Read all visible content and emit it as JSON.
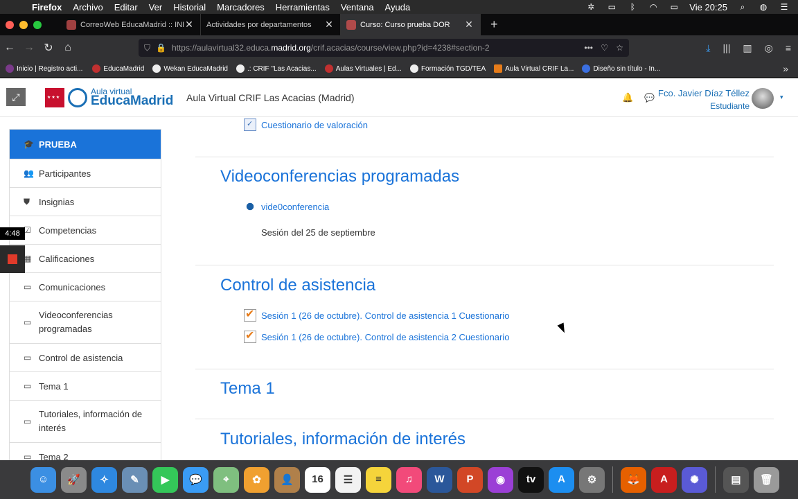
{
  "menubar": {
    "apple": "",
    "app": "Firefox",
    "menus": [
      "Archivo",
      "Editar",
      "Ver",
      "Historial",
      "Marcadores",
      "Herramientas",
      "Ventana",
      "Ayuda"
    ],
    "clock": "Vie 20:25"
  },
  "tabs": [
    {
      "title": "CorreoWeb EducaMadrid :: INB",
      "close": "✕"
    },
    {
      "title": "Actividades por departamentos",
      "close": "✕"
    },
    {
      "title": "Curso: Curso prueba DOR",
      "close": "✕",
      "active": true
    }
  ],
  "newtab": "+",
  "url": {
    "prefix": "https://aulavirtual32.educa.",
    "host": "madrid.org",
    "path": "/crif.acacias/course/view.php?id=4238#section-2"
  },
  "nav": {
    "back": "←",
    "forward": "→",
    "reload": "↻",
    "home": "⌂",
    "more": "•••"
  },
  "bookmarks": [
    "Inicio | Registro acti...",
    "EducaMadrid",
    "Wekan EducaMadrid",
    ".: CRIF \"Las Acacias...",
    "Aulas Virtuales | Ed...",
    "Formación TGD/TEA",
    "Aula Virtual CRIF La...",
    "Diseño sin título - In..."
  ],
  "bookmarks_more": "»",
  "header": {
    "expand": "⤢",
    "logo_line1": "Aula virtual",
    "logo_line2": "EducaMadrid",
    "site_title": "Aula Virtual CRIF Las Acacias (Madrid)",
    "user_name": "Fco. Javier Díaz Téllez",
    "user_role": "Estudiante",
    "bell": "🔔",
    "chat": "💬",
    "caret": "▾"
  },
  "recorder": {
    "time": "4:48"
  },
  "sidebar": {
    "items": [
      {
        "icon": "🎓",
        "label": "PRUEBA"
      },
      {
        "icon": "👥",
        "label": "Participantes"
      },
      {
        "icon": "⛊",
        "label": "Insignias"
      },
      {
        "icon": "☑",
        "label": "Competencias"
      },
      {
        "icon": "▦",
        "label": "Calificaciones"
      },
      {
        "icon": "▭",
        "label": "Comunicaciones"
      },
      {
        "icon": "▭",
        "label": "Videoconferencias programadas"
      },
      {
        "icon": "▭",
        "label": "Control de asistencia"
      },
      {
        "icon": "▭",
        "label": "Tema 1"
      },
      {
        "icon": "▭",
        "label": "Tutoriales, información de interés"
      },
      {
        "icon": "▭",
        "label": "Tema 2"
      }
    ]
  },
  "main": {
    "top_activity": "Cuestionario de valoración",
    "sections": [
      {
        "title": "Videoconferencias programadas",
        "activity": "vide0conferencia",
        "description": "Sesión del 25 de septiembre"
      },
      {
        "title": "Control de asistencia",
        "activities": [
          "Sesión 1 (26 de octubre). Control de asistencia 1 Cuestionario",
          "Sesión 1 (26 de octubre). Control de asistencia 2 Cuestionario"
        ]
      },
      {
        "title": "Tema 1"
      },
      {
        "title": "Tutoriales, información de interés"
      }
    ]
  },
  "dock": {
    "apps": [
      {
        "name": "finder-icon",
        "color": "#3b8fe3",
        "glyph": "☺"
      },
      {
        "name": "launchpad-icon",
        "color": "#8a8a8a",
        "glyph": "🚀"
      },
      {
        "name": "safari-icon",
        "color": "#2e88e0",
        "glyph": "✧"
      },
      {
        "name": "preview-icon",
        "color": "#6a8fb5",
        "glyph": "✎"
      },
      {
        "name": "facetime-icon",
        "color": "#34c759",
        "glyph": "▶"
      },
      {
        "name": "messages-icon",
        "color": "#3a9cf5",
        "glyph": "💬"
      },
      {
        "name": "maps-icon",
        "color": "#7fbf7f",
        "glyph": "⌖"
      },
      {
        "name": "photos-icon",
        "color": "#f0a030",
        "glyph": "✿"
      },
      {
        "name": "contacts-icon",
        "color": "#b0804a",
        "glyph": "👤"
      },
      {
        "name": "calendar-icon",
        "color": "#ffffff",
        "glyph": "16"
      },
      {
        "name": "reminders-icon",
        "color": "#f2f2f2",
        "glyph": "☰"
      },
      {
        "name": "notes-icon",
        "color": "#f5d43b",
        "glyph": "≡"
      },
      {
        "name": "itunes-icon",
        "color": "#f24a7a",
        "glyph": "♫"
      },
      {
        "name": "word-icon",
        "color": "#2b579a",
        "glyph": "W"
      },
      {
        "name": "powerpoint-icon",
        "color": "#d24726",
        "glyph": "P"
      },
      {
        "name": "podcasts-icon",
        "color": "#9b3fd6",
        "glyph": "◉"
      },
      {
        "name": "appletv-icon",
        "color": "#111111",
        "glyph": "tv"
      },
      {
        "name": "appstore-icon",
        "color": "#1c8ef0",
        "glyph": "A"
      },
      {
        "name": "system-preferences-icon",
        "color": "#777777",
        "glyph": "⚙"
      },
      {
        "name": "firefox-icon",
        "color": "#e66000",
        "glyph": "🦊"
      },
      {
        "name": "acrobat-icon",
        "color": "#c81e1e",
        "glyph": "A"
      },
      {
        "name": "gear-app-icon",
        "color": "#5a5ad6",
        "glyph": "✺"
      },
      {
        "name": "screenshot-thumb-icon",
        "color": "#555555",
        "glyph": "▤"
      },
      {
        "name": "trash-icon",
        "color": "#9a9a9a",
        "glyph": "🗑"
      }
    ]
  }
}
